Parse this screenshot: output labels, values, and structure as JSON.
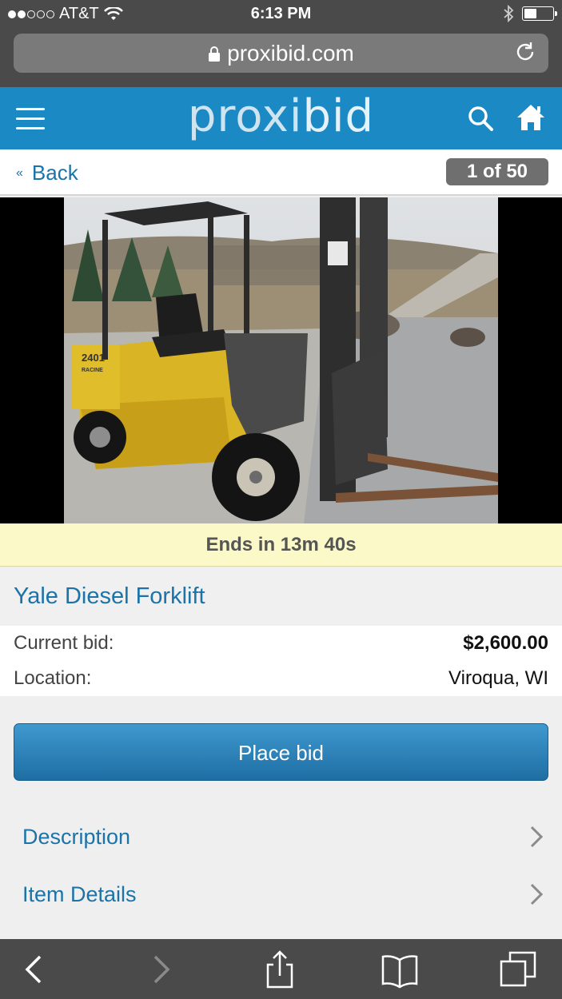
{
  "status_bar": {
    "carrier": "AT&T",
    "time": "6:13 PM",
    "signal_filled": 2,
    "signal_total": 5,
    "battery_level": 0.4
  },
  "browser": {
    "url": "proxibid.com"
  },
  "header": {
    "logo_part1": "proxi",
    "logo_part2": "bid",
    "brand_color": "#1a89c4"
  },
  "nav": {
    "back_label": "Back",
    "back_chevron": "«",
    "pager_text": "1 of 50"
  },
  "lot": {
    "countdown": "Ends in 13m 40s",
    "title": "Yale Diesel Forklift",
    "current_bid_label": "Current bid:",
    "current_bid_value": "$2,600.00",
    "location_label": "Location:",
    "location_value": "Viroqua, WI",
    "place_bid_label": "Place bid"
  },
  "sections": [
    {
      "label": "Description"
    },
    {
      "label": "Item Details"
    }
  ],
  "photo": {
    "forklift_decal": "2401",
    "forklift_decal2": "RACINE"
  },
  "toolbar": {
    "icons": [
      "back-icon",
      "forward-icon",
      "share-icon",
      "bookmarks-icon",
      "tabs-icon"
    ]
  }
}
